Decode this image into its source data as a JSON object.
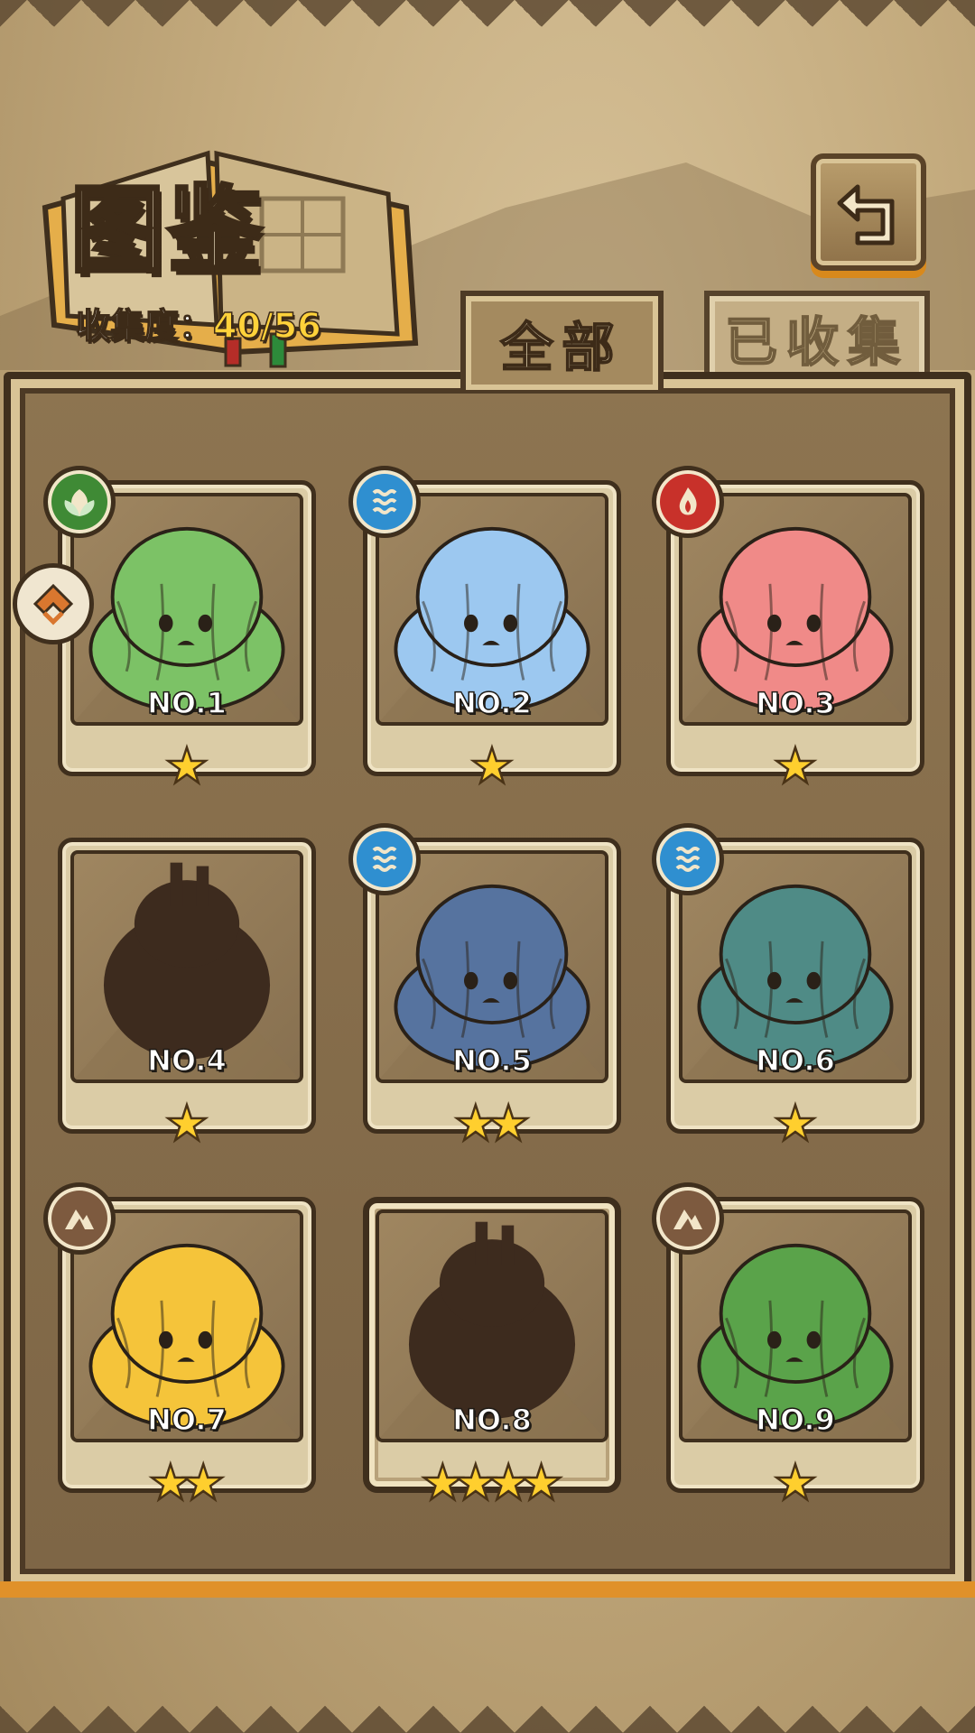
{
  "header": {
    "title": "图鉴",
    "collection_label": "收集度：",
    "collection_value": "40/56"
  },
  "tabs": [
    {
      "label": "全部",
      "active": true
    },
    {
      "label": "已收集",
      "active": false
    }
  ],
  "cards": [
    {
      "number": "NO.1",
      "stars": 1,
      "element": "grass-icon",
      "color": "#7cc266"
    },
    {
      "number": "NO.2",
      "stars": 1,
      "element": "water-icon",
      "color": "#9cc8f0"
    },
    {
      "number": "NO.3",
      "stars": 1,
      "element": "fire-icon",
      "color": "#f08a88"
    },
    {
      "number": "NO.4",
      "stars": 1,
      "element": "",
      "color": "#3d2b1e"
    },
    {
      "number": "NO.5",
      "stars": 2,
      "element": "water-icon",
      "color": "#56739f"
    },
    {
      "number": "NO.6",
      "stars": 1,
      "element": "water-icon",
      "color": "#4f8b86"
    },
    {
      "number": "NO.7",
      "stars": 2,
      "element": "earth-icon",
      "color": "#f5c43a"
    },
    {
      "number": "NO.8",
      "stars": 4,
      "element": "",
      "color": "#3d2b1e"
    },
    {
      "number": "NO.9",
      "stars": 1,
      "element": "earth-icon",
      "color": "#5aa34a"
    }
  ],
  "colors": {
    "panel": "#7e6646",
    "frame": "#dbcca6",
    "star": "#ffcf2e",
    "accent": "#ffd23a"
  }
}
